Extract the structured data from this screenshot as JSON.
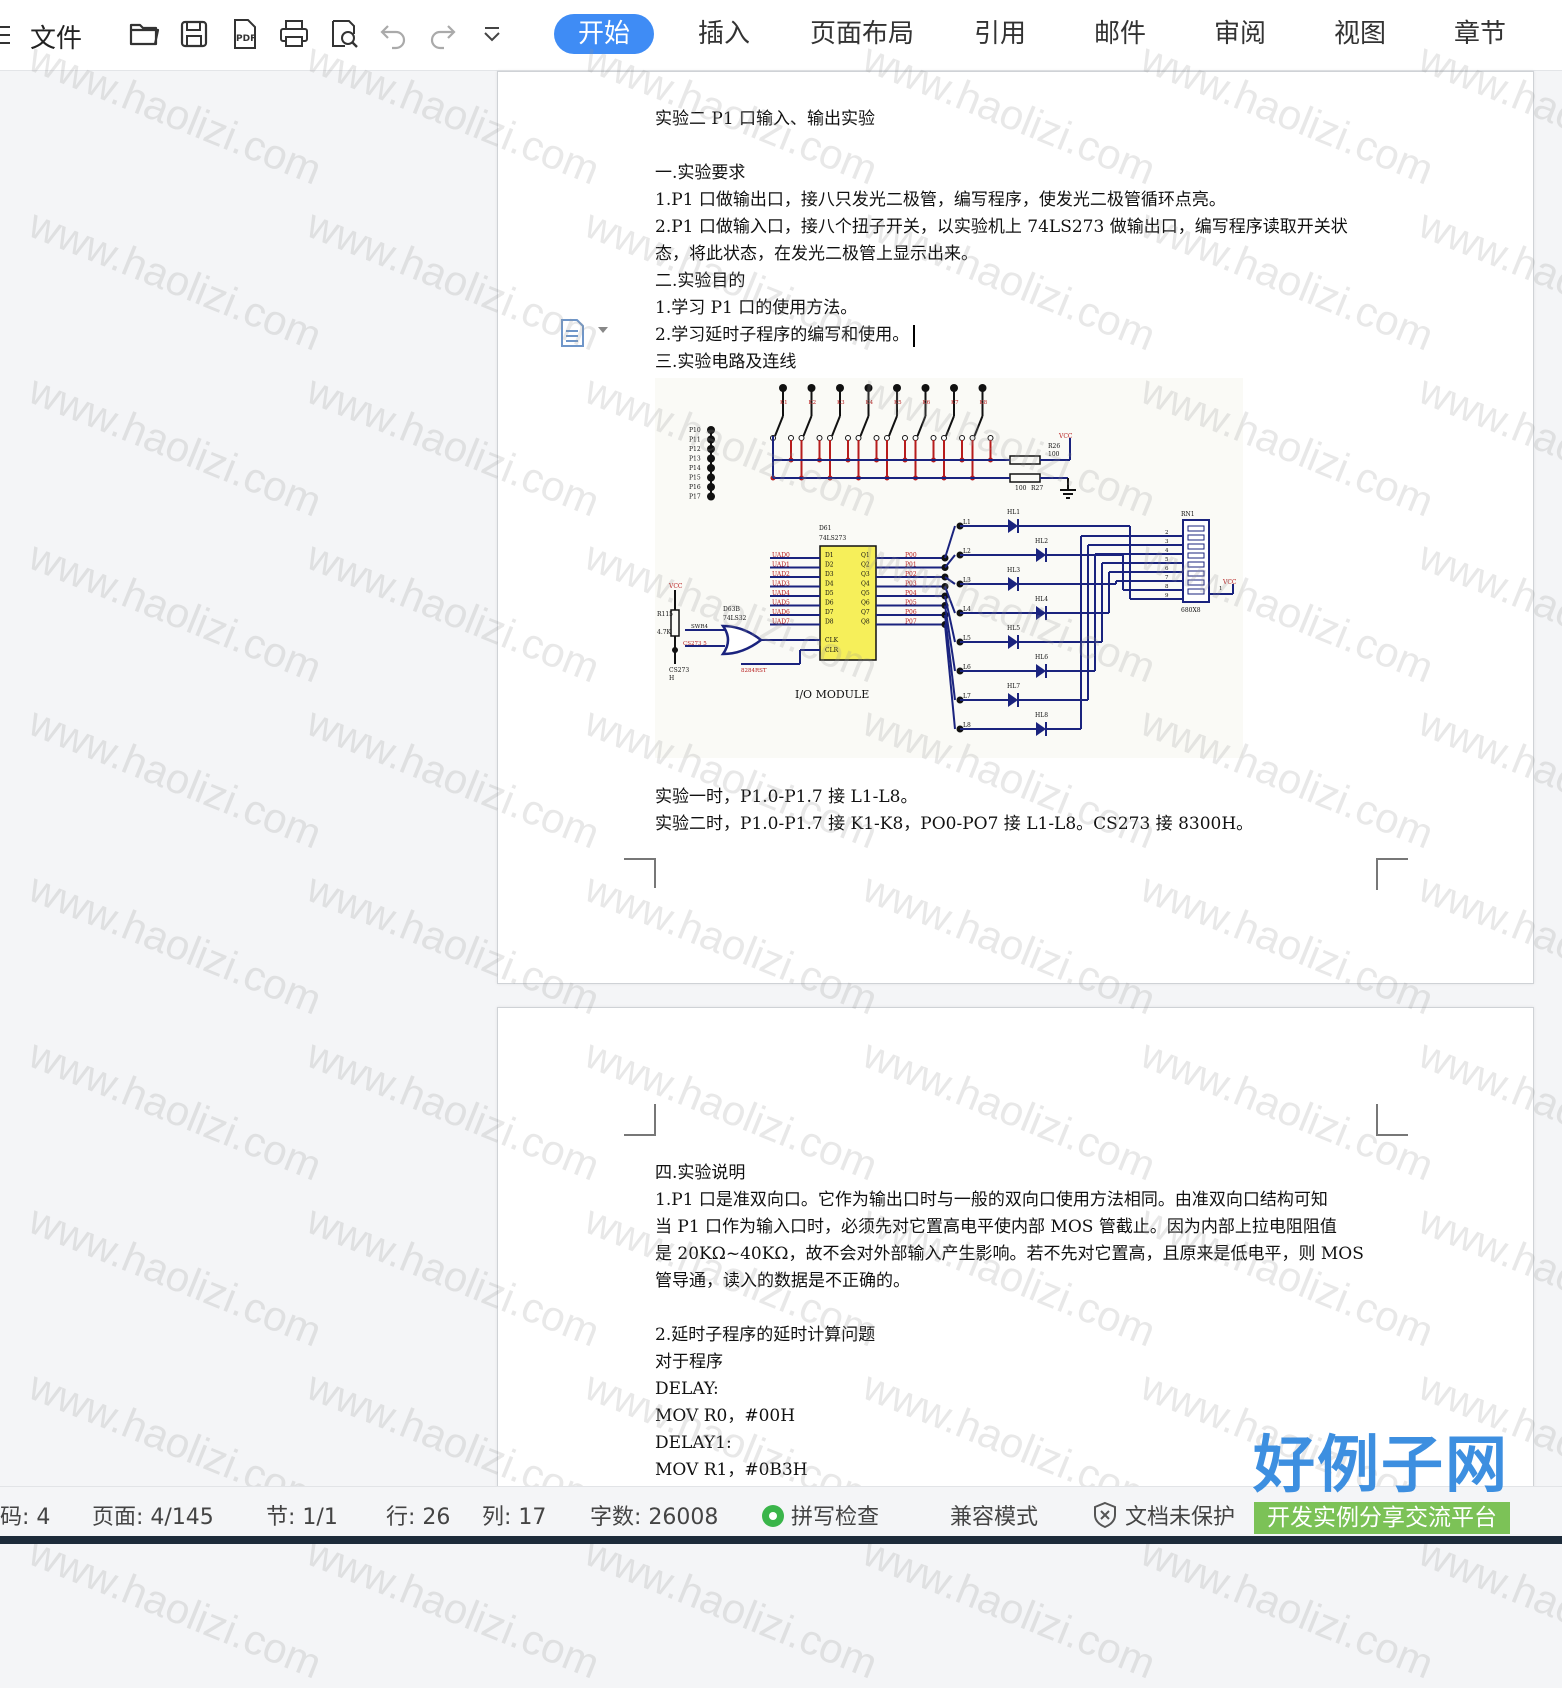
{
  "toolbar": {
    "file_label": "文件",
    "tabs": [
      {
        "label": "开始",
        "active": true
      },
      {
        "label": "插入"
      },
      {
        "label": "页面布局"
      },
      {
        "label": "引用"
      },
      {
        "label": "邮件"
      },
      {
        "label": "审阅"
      },
      {
        "label": "视图"
      },
      {
        "label": "章节"
      }
    ],
    "accent_color": "#3f8cf5"
  },
  "page1": {
    "title": "实验二  P1 口输入、输出实验",
    "lines": [
      "一.实验要求",
      "1.P1 口做输出口，接八只发光二极管，编写程序，使发光二极管循环点亮。",
      "2.P1 口做输入口，接八个扭子开关，以实验机上 74LS273 做输出口，编写程序读取开关状",
      "态，将此状态，在发光二极管上显示出来。",
      "二.实验目的",
      "1.学习 P1 口的使用方法。",
      "2.学习延时子程序的编写和使用。",
      "三.实验电路及连线"
    ],
    "after_lines": [
      "实验一时，P1.0-P1.7 接 L1-L8。",
      "实验二时，P1.0-P1.7 接 K1-K8，PO0-PO7 接 L1-L8。CS273 接 8300H。"
    ],
    "figure": {
      "module_label": "I/O MODULE",
      "chip_label": "D61",
      "chip_part": "74LS273",
      "gate_label": "D63B",
      "gate_part": "74LS32",
      "resistor_label": "R115",
      "resistor_value": "4.7K",
      "pull_label": "R26",
      "pull_value": "100",
      "pull2_label": "R27",
      "pull2_value": "100",
      "pack_label": "RN1",
      "pack_part": "680X8",
      "vcc": "VCC",
      "cs_label": "CS273",
      "wr_label": "SWR4",
      "cs_net": "CS273 5",
      "reset_net": "8284RST",
      "h_label": "H",
      "p1_pins": [
        "P10",
        "P11",
        "P12",
        "P13",
        "P14",
        "P15",
        "P16",
        "P17"
      ],
      "switch_labels": [
        "K1",
        "K2",
        "K3",
        "K4",
        "K5",
        "K6",
        "K7",
        "K8"
      ],
      "led_labels": [
        "HL1",
        "HL2",
        "HL3",
        "HL4",
        "HL5",
        "HL6",
        "HL7",
        "HL8"
      ],
      "l_labels": [
        "L1",
        "L2",
        "L3",
        "L4",
        "L5",
        "L6",
        "L7",
        "L8"
      ],
      "uad_labels": [
        "UAD0",
        "UAD1",
        "UAD2",
        "UAD3",
        "UAD4",
        "UAD5",
        "UAD6",
        "UAD7"
      ],
      "d_pins": [
        "D1",
        "D2",
        "D3",
        "D4",
        "D5",
        "D6",
        "D7",
        "D8"
      ],
      "q_pins": [
        "Q1",
        "Q2",
        "Q3",
        "Q4",
        "Q5",
        "Q6",
        "Q7",
        "Q8"
      ],
      "po_labels": [
        "P00",
        "P01",
        "P02",
        "P03",
        "P04",
        "P05",
        "P06",
        "P07"
      ],
      "clk_label": "CLK",
      "clr_label": "CLR"
    }
  },
  "page2": {
    "lines": [
      "四.实验说明",
      "1.P1 口是准双向口。它作为输出口时与一般的双向口使用方法相同。由准双向口结构可知",
      "当 P1 口作为输入口时，必须先对它置高电平使内部 MOS 管截止。因为内部上拉电阻阻值",
      "是 20KΩ~40KΩ，故不会对外部输入产生影响。若不先对它置高，且原来是低电平，则 MOS",
      "管导通，读入的数据是不正确的。",
      "",
      "2.延时子程序的延时计算问题",
      "对于程序",
      "DELAY:",
      "MOV R0，#00H",
      "DELAY1:",
      "MOV R1，#0B3H"
    ]
  },
  "status": {
    "code": "码: 4",
    "page": "页面: 4/145",
    "section": "节: 1/1",
    "row": "行: 26",
    "col": "列: 17",
    "words": "字数: 26008",
    "spell": "拼写检查",
    "compat": "兼容模式",
    "protect": "文档未保护"
  },
  "watermark": "www.haolizi.com",
  "brand": {
    "name": "好例子网",
    "slogan": "开发实例分享交流平台"
  }
}
